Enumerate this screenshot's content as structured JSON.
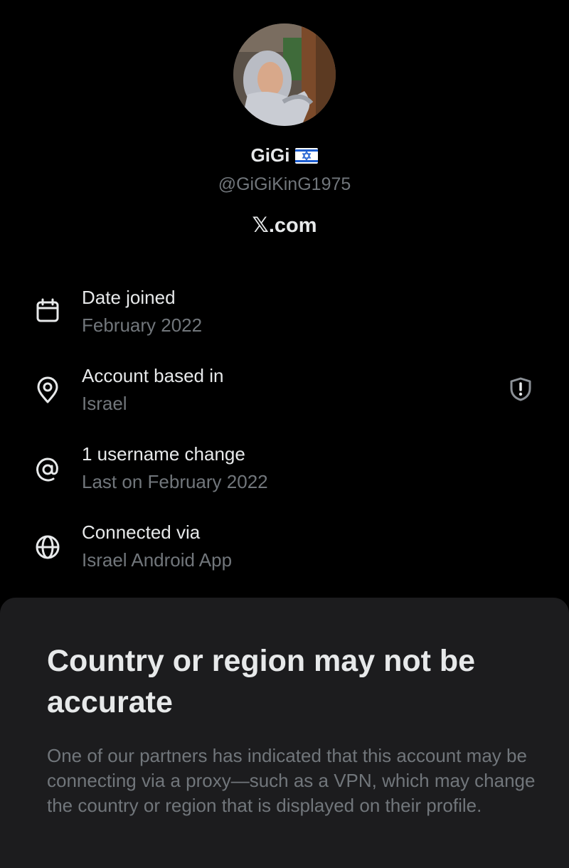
{
  "profile": {
    "display_name": "GiGi",
    "flag_icon": "israel-flag-icon",
    "handle": "@GiGiKinG1975",
    "site_label": "𝕏.com"
  },
  "about": {
    "items": [
      {
        "icon": "calendar-icon",
        "title": "Date joined",
        "subtitle": "February 2022"
      },
      {
        "icon": "location-pin-icon",
        "title": "Account based in",
        "subtitle": "Israel"
      },
      {
        "icon": "at-sign-icon",
        "title": "1 username change",
        "subtitle": "Last on February 2022"
      },
      {
        "icon": "globe-icon",
        "title": "Connected via",
        "subtitle": "Israel Android App"
      }
    ],
    "warning_icon": "shield-alert-icon"
  },
  "sheet": {
    "title": "Country or region may not be accurate",
    "body": "One of our partners has indicated that this account may be connecting via a proxy—such as a VPN, which may change the country or region that is displayed on their profile."
  },
  "colors": {
    "background": "#000000",
    "primary_text": "#e7e9ea",
    "secondary_text": "#71767b",
    "sheet_background": "#1c1c1e",
    "flag_blue": "#1f5fd1"
  }
}
